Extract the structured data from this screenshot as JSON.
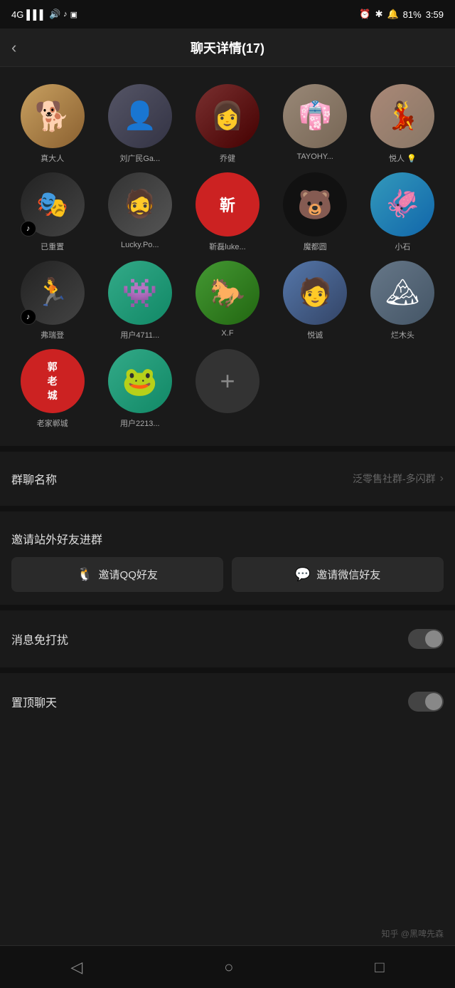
{
  "statusBar": {
    "network": "4G",
    "signal": "▌▌▌",
    "time": "3:59",
    "battery": "81%",
    "icons": "⏰ ✱ 🔊"
  },
  "header": {
    "back": "‹",
    "title": "聊天详情(17)"
  },
  "members": [
    {
      "name": "真大人",
      "avatarType": "dog",
      "hasTiktok": false
    },
    {
      "name": "刘广民Ga...",
      "avatarType": "person1",
      "hasTiktok": false
    },
    {
      "name": "乔健",
      "avatarType": "person2",
      "hasTiktok": false
    },
    {
      "name": "TAYOHY...",
      "avatarType": "person3",
      "hasTiktok": false
    },
    {
      "name": "悦人 💡",
      "avatarType": "person4",
      "hasTiktok": false
    },
    {
      "name": "已重置",
      "avatarType": "tiktok",
      "hasTiktok": true
    },
    {
      "name": "Lucky.Po...",
      "avatarType": "lucky",
      "hasTiktok": false
    },
    {
      "name": "靳磊luke...",
      "avatarType": "red",
      "hasTiktok": false
    },
    {
      "name": "魔都圆",
      "avatarType": "bear",
      "hasTiktok": false
    },
    {
      "name": "小石",
      "avatarType": "blue",
      "hasTiktok": false
    },
    {
      "name": "弗瑞登",
      "avatarType": "run",
      "hasTiktok": true
    },
    {
      "name": "用户4711...",
      "avatarType": "monster",
      "hasTiktok": false
    },
    {
      "name": "X.F",
      "avatarType": "horse",
      "hasTiktok": false
    },
    {
      "name": "悦诚",
      "avatarType": "blue2",
      "hasTiktok": false
    },
    {
      "name": "烂木头",
      "avatarType": "photo",
      "hasTiktok": false
    },
    {
      "name": "老家郸城",
      "avatarType": "郭",
      "hasTiktok": false
    },
    {
      "name": "用户2213...",
      "avatarType": "frog",
      "hasTiktok": false
    }
  ],
  "addButton": "+",
  "settings": {
    "groupName": {
      "label": "群聊名称",
      "value": "泛零售社群-多闪群"
    },
    "invite": {
      "title": "邀请站外好友进群",
      "qq": "邀请QQ好友",
      "wechat": "邀请微信好友"
    },
    "doNotDisturb": {
      "label": "消息免打扰",
      "enabled": false
    },
    "pinChat": {
      "label": "置顶聊天",
      "enabled": false
    }
  },
  "bottomNav": {
    "back": "◁",
    "home": "○",
    "recent": "□"
  },
  "watermark": "知乎 @黑啤先森"
}
